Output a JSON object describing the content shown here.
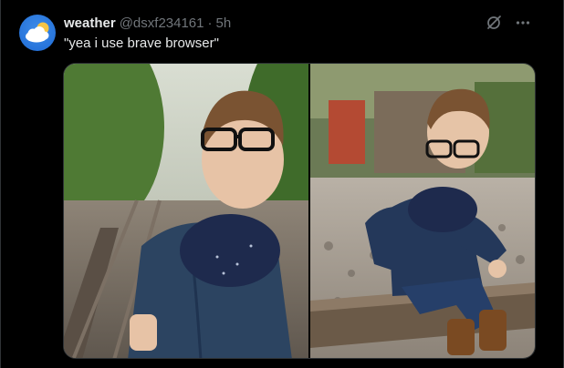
{
  "post": {
    "author_name": "weather",
    "handle": "@dsxf234161",
    "separator": "·",
    "time": "5h",
    "text": "\"yea i use brave browser\""
  },
  "icons": {
    "avatar": "weather-cloud-sun-avatar",
    "grok": "grok-icon",
    "more": "more-options-icon"
  },
  "media": {
    "images": [
      "photo-left",
      "photo-right"
    ]
  },
  "colors": {
    "background": "#000000",
    "primary_text": "#e7e9ea",
    "secondary_text": "#71767b",
    "border": "#2f3336"
  }
}
